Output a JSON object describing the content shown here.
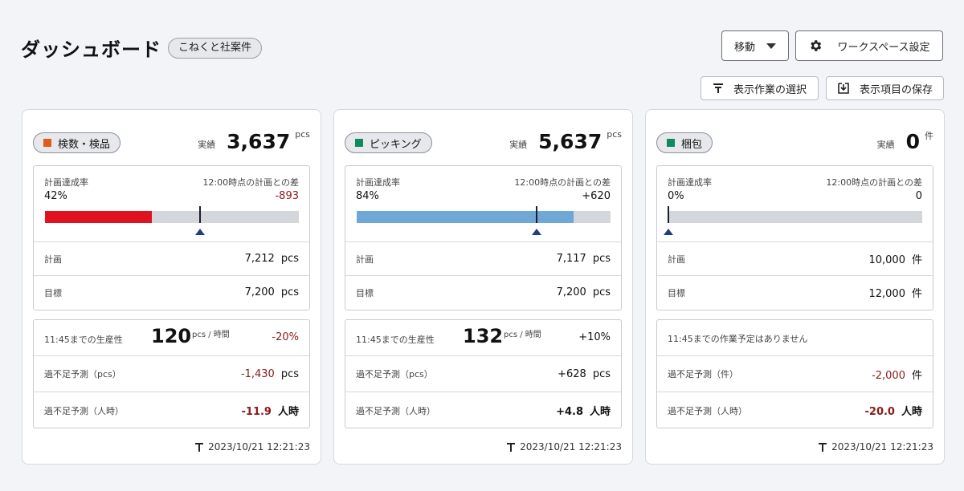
{
  "header": {
    "title": "ダッシュボード",
    "company": "こねくと社案件",
    "move_label": "移動",
    "workspace_label": "ワークスペース設定",
    "select_tasks_label": "表示作業の選択",
    "save_items_label": "表示項目の保存"
  },
  "colors": {
    "red": "#e0121f",
    "blue": "#6fa8d6",
    "green": "#0f8a5f",
    "orange": "#e25a1c"
  },
  "cards": [
    {
      "category": "検数・検品",
      "category_color": "#e25a1c",
      "actual_label": "実績",
      "actual_value": "3,637",
      "actual_unit": "pcs",
      "rate_label": "計画達成率",
      "rate_value": "42%",
      "rate_fraction": 0.42,
      "plan_marker_fraction": 0.61,
      "diff_label": "12:00時点の計画との差",
      "diff_value": "-893",
      "bar_color": "#e0121f",
      "plan_label": "計画",
      "plan_value": "7,212",
      "plan_unit": "pcs",
      "target_label": "目標",
      "target_value": "7,200",
      "target_unit": "pcs",
      "prod_label": "11:45までの生産性",
      "prod_value": "120",
      "prod_unit": "pcs / 時間",
      "prod_delta": "-20%",
      "forecast_label": "過不足予測（pcs）",
      "forecast_value": "-1,430",
      "forecast_unit": "pcs",
      "forecast_mh_label": "過不足予測（人時）",
      "forecast_mh_value": "-11.9",
      "forecast_mh_unit": "人時",
      "timestamp": "2023/10/21 12:21:23"
    },
    {
      "category": "ピッキング",
      "category_color": "#0f8a5f",
      "actual_label": "実績",
      "actual_value": "5,637",
      "actual_unit": "pcs",
      "rate_label": "計画達成率",
      "rate_value": "84%",
      "rate_fraction": 0.855,
      "plan_marker_fraction": 0.71,
      "diff_label": "12:00時点の計画との差",
      "diff_value": "+620",
      "bar_color": "#6fa8d6",
      "plan_label": "計画",
      "plan_value": "7,117",
      "plan_unit": "pcs",
      "target_label": "目標",
      "target_value": "7,200",
      "target_unit": "pcs",
      "prod_label": "11:45までの生産性",
      "prod_value": "132",
      "prod_unit": "pcs / 時間",
      "prod_delta": "+10%",
      "forecast_label": "過不足予測（pcs）",
      "forecast_value": "+628",
      "forecast_unit": "pcs",
      "forecast_mh_label": "過不足予測（人時）",
      "forecast_mh_value": "+4.8",
      "forecast_mh_unit": "人時",
      "timestamp": "2023/10/21 12:21:23"
    },
    {
      "category": "梱包",
      "category_color": "#0f8a5f",
      "actual_label": "実績",
      "actual_value": "0",
      "actual_unit": "件",
      "rate_label": "計画達成率",
      "rate_value": "0%",
      "rate_fraction": 0,
      "plan_marker_fraction": 0.0,
      "diff_label": "12:00時点の計画との差",
      "diff_value": "0",
      "bar_color": "#6fa8d6",
      "plan_label": "計画",
      "plan_value": "10,000",
      "plan_unit": "件",
      "target_label": "目標",
      "target_value": "12,000",
      "target_unit": "件",
      "prod_none": "11:45までの作業予定はありません",
      "forecast_label": "過不足予測（件）",
      "forecast_value": "-2,000",
      "forecast_unit": "件",
      "forecast_mh_label": "過不足予測（人時）",
      "forecast_mh_value": "-20.0",
      "forecast_mh_unit": "人時",
      "timestamp": "2023/10/21 12:21:23"
    }
  ]
}
